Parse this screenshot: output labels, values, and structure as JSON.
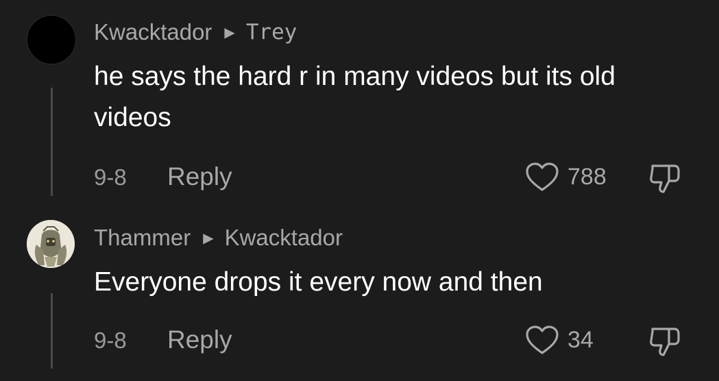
{
  "comments": [
    {
      "author": "Kwacktador",
      "reply_to": "Trey",
      "text": "he says the hard r in many videos but its old videos",
      "date": "9-8",
      "reply_label": "Reply",
      "likes": "788"
    },
    {
      "author": "Thammer",
      "reply_to": "Kwacktador",
      "text": "Everyone drops it every now and then",
      "date": "9-8",
      "reply_label": "Reply",
      "likes": "34"
    }
  ],
  "icons": {
    "reply_arrow": "triangle-right-icon",
    "like": "heart-icon",
    "dislike": "thumbs-down-icon"
  },
  "colors": {
    "background": "#1c1c1c",
    "text": "#ffffff",
    "muted": "#a8a8a8"
  }
}
